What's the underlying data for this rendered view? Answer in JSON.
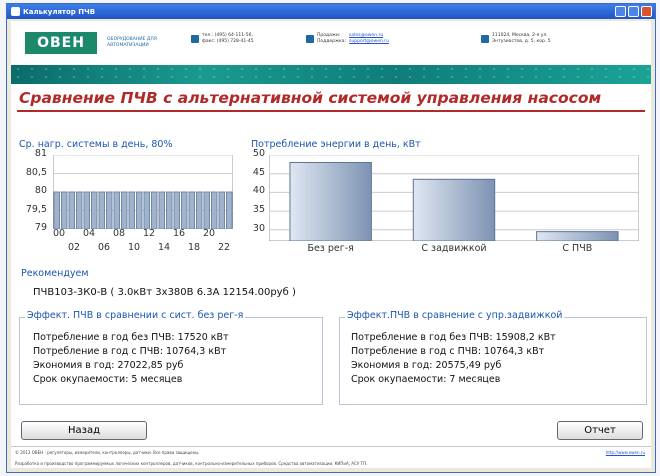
{
  "window": {
    "title": "Калькулятор ПЧВ"
  },
  "header": {
    "logo_text": "ОВЕН",
    "slogan": "ОБОРУДОВАНИЕ ДЛЯ АВТОМАТИЗАЦИИ",
    "phones": "тел.: (495) 64-111-56,\nфакс: (495) 728-41-45",
    "mail_labels": "Продажи:\nПоддержка:",
    "sales_email": "sales@owen.ru",
    "support_email": "support@owen.ru",
    "address": "111024, Москва, 2-я ул.\nЭнтузиастов, д. 5, кор. 5"
  },
  "page_title": "Сравнение ПЧВ с альтернативной системой управления насосом",
  "chart_data": [
    {
      "type": "bar",
      "title": "Ср. нагр. системы в день, 80%",
      "categories": [
        "00",
        "02",
        "04",
        "06",
        "08",
        "10",
        "12",
        "14",
        "16",
        "18",
        "20",
        "22"
      ],
      "values": [
        80,
        80,
        80,
        80,
        80,
        80,
        80,
        80,
        80,
        80,
        80,
        80,
        80,
        80,
        80,
        80,
        80,
        80,
        80,
        80,
        80,
        80,
        80,
        80
      ],
      "x_tick_labels_top": [
        "00",
        "04",
        "08",
        "12",
        "16",
        "20"
      ],
      "x_tick_labels_bottom": [
        "02",
        "06",
        "10",
        "14",
        "18",
        "22"
      ],
      "ylim": [
        79,
        81
      ],
      "yticks": [
        "81",
        "80,5",
        "80",
        "79,5",
        "79"
      ],
      "grid": true
    },
    {
      "type": "bar",
      "title": "Потребление энергии в день, кВт",
      "categories": [
        "Без рег-я",
        "С задвижкой",
        "С ПЧВ"
      ],
      "values": [
        48,
        43.5,
        29.5
      ],
      "ylim": [
        27,
        50
      ],
      "yticks": [
        "50",
        "45",
        "40",
        "35",
        "30"
      ],
      "grid": true
    }
  ],
  "recommend": {
    "label": "Рекомендуем",
    "value": "ПЧВ103-3К0-В  ( 3.0кВт 3х380В 6.3А 12154.00руб )"
  },
  "left_box": {
    "title": "Эффект. ПЧВ в сравнении с сист. без рег-я",
    "lines": [
      "Потребление в год без ПЧВ: 17520 кВт",
      "Потребление в год с ПЧВ: 10764,3 кВт",
      "Экономия в год: 27022,85 руб",
      "Срок окупаемости: 5 месяцев"
    ]
  },
  "right_box": {
    "title": "Эффект.ПЧВ в сравнение с упр.задвижкой",
    "lines": [
      "Потребление в год без ПЧВ: 15908,2 кВт",
      "Потребление в год с ПЧВ: 10764,3 кВт",
      "Экономия в год: 20575,49 руб",
      "Срок окупаемости: 7 месяцев"
    ]
  },
  "buttons": {
    "back": "Назад",
    "report": "Отчет"
  },
  "footer": {
    "copyright": "© 2013 ОВЕН - регуляторы, измерители, контроллеры, датчики. Все права защищены.",
    "site": "http://www.owen.ru",
    "description": "Разработка и производство программируемых логических контроллеров, датчиков, контрольно-измерительных приборов. Средства автоматизации, КИПиА, АСУ ТП."
  },
  "colors": {
    "accent": "#1b56b0",
    "title_red": "#b12a2a",
    "banner": "#0f7d7a"
  }
}
